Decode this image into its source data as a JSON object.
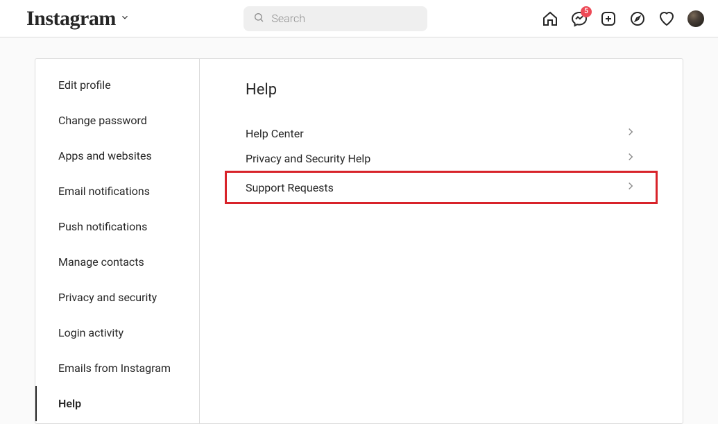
{
  "brand": "Instagram",
  "search": {
    "placeholder": "Search"
  },
  "badge_count": "5",
  "sidebar": {
    "items": [
      {
        "label": "Edit profile"
      },
      {
        "label": "Change password"
      },
      {
        "label": "Apps and websites"
      },
      {
        "label": "Email notifications"
      },
      {
        "label": "Push notifications"
      },
      {
        "label": "Manage contacts"
      },
      {
        "label": "Privacy and security"
      },
      {
        "label": "Login activity"
      },
      {
        "label": "Emails from Instagram"
      },
      {
        "label": "Help"
      }
    ]
  },
  "main": {
    "title": "Help",
    "rows": [
      {
        "label": "Help Center"
      },
      {
        "label": "Privacy and Security Help"
      },
      {
        "label": "Support Requests"
      }
    ]
  }
}
